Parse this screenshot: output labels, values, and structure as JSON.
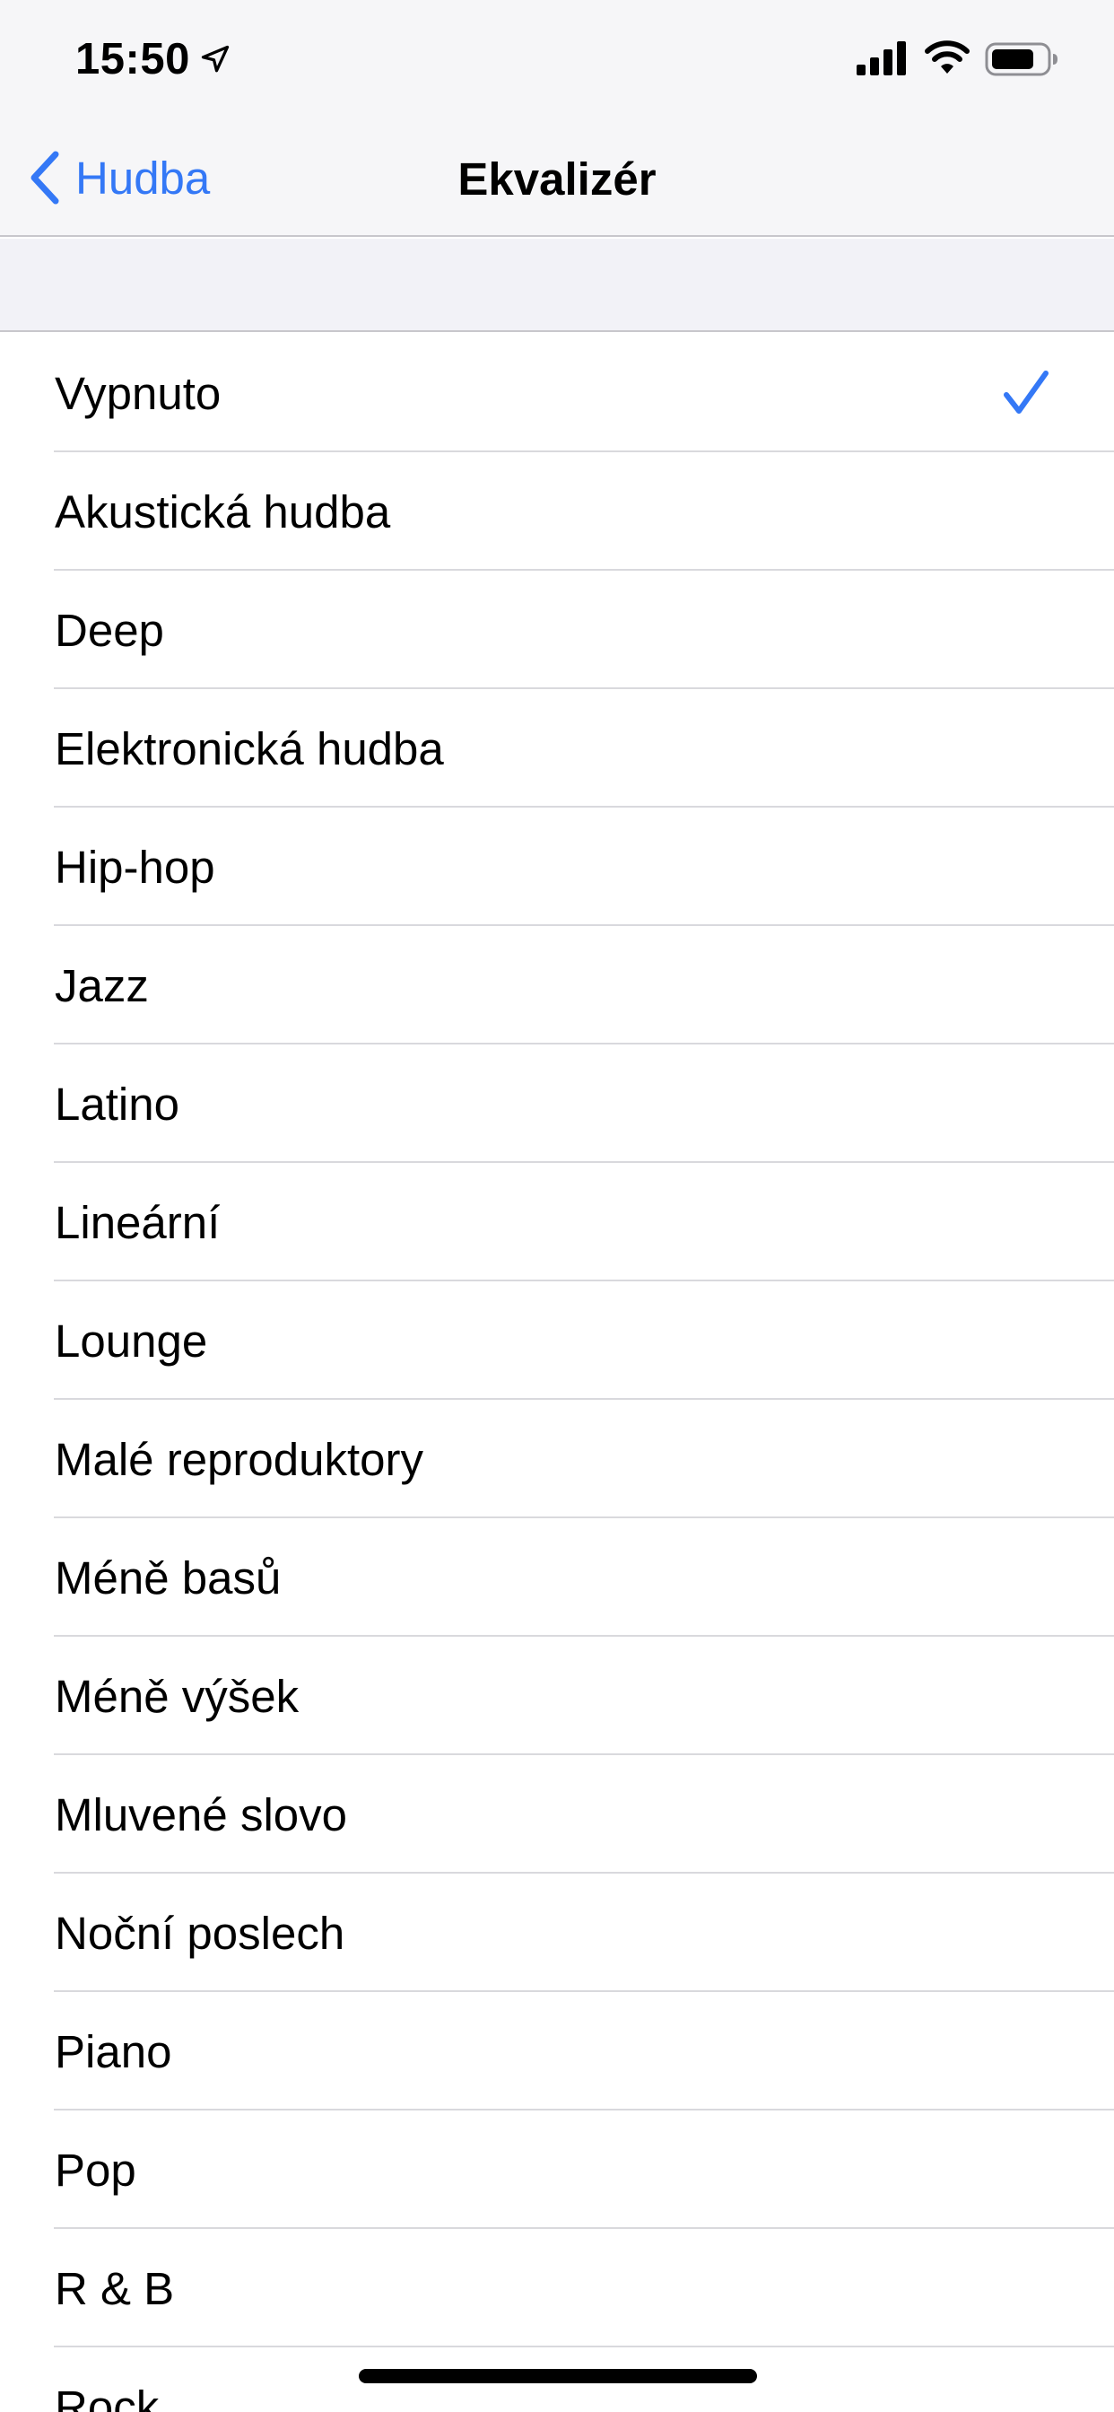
{
  "status_bar": {
    "time": "15:50",
    "icons": [
      "location-arrow-icon",
      "signal-icon",
      "wifi-icon",
      "battery-icon"
    ]
  },
  "nav": {
    "back_label": "Hudba",
    "title": "Ekvalizér"
  },
  "accent_color": "#3478f6",
  "equalizer": {
    "selected": "Vypnuto",
    "items": [
      {
        "label": "Vypnuto",
        "checked": true
      },
      {
        "label": "Akustická hudba",
        "checked": false
      },
      {
        "label": "Deep",
        "checked": false
      },
      {
        "label": "Elektronická hudba",
        "checked": false
      },
      {
        "label": "Hip-hop",
        "checked": false
      },
      {
        "label": "Jazz",
        "checked": false
      },
      {
        "label": "Latino",
        "checked": false
      },
      {
        "label": "Lineární",
        "checked": false
      },
      {
        "label": "Lounge",
        "checked": false
      },
      {
        "label": "Malé reproduktory",
        "checked": false
      },
      {
        "label": "Méně basů",
        "checked": false
      },
      {
        "label": "Méně výšek",
        "checked": false
      },
      {
        "label": "Mluvené slovo",
        "checked": false
      },
      {
        "label": "Noční poslech",
        "checked": false
      },
      {
        "label": "Piano",
        "checked": false
      },
      {
        "label": "Pop",
        "checked": false
      },
      {
        "label": "R & B",
        "checked": false
      },
      {
        "label": "Rock",
        "checked": false
      }
    ]
  }
}
